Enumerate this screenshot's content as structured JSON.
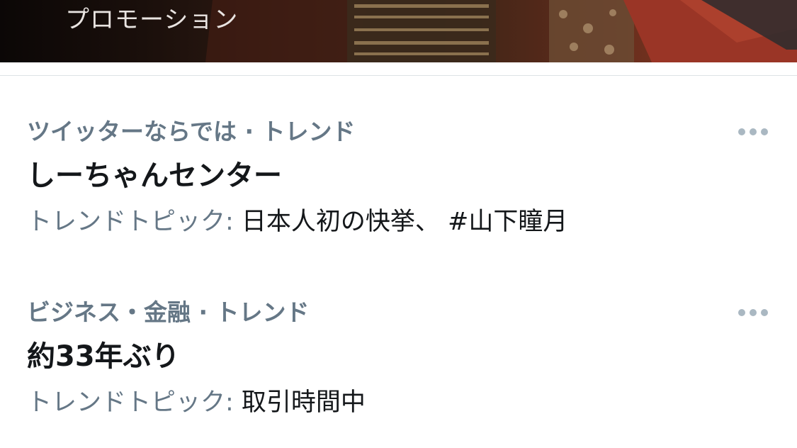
{
  "promotion": {
    "label": "プロモーション"
  },
  "trends": [
    {
      "meta": "ツイッターならでは · トレンド",
      "name": "しーちゃんセンター",
      "topic_prefix": "トレンドトピック:",
      "topic_text": " 日本人初の快挙、 #山下瞳月",
      "more_icon": "more-horizontal-icon"
    },
    {
      "meta": "ビジネス・金融 · トレンド",
      "name": "約33年ぶり",
      "topic_prefix": "トレンドトピック:",
      "topic_text": " 取引時間中",
      "more_icon": "more-horizontal-icon"
    }
  ],
  "colors": {
    "secondary_text": "#657786",
    "primary_text": "#14171a",
    "icon_gray": "#aab8c2",
    "divider": "#dde2e6"
  }
}
